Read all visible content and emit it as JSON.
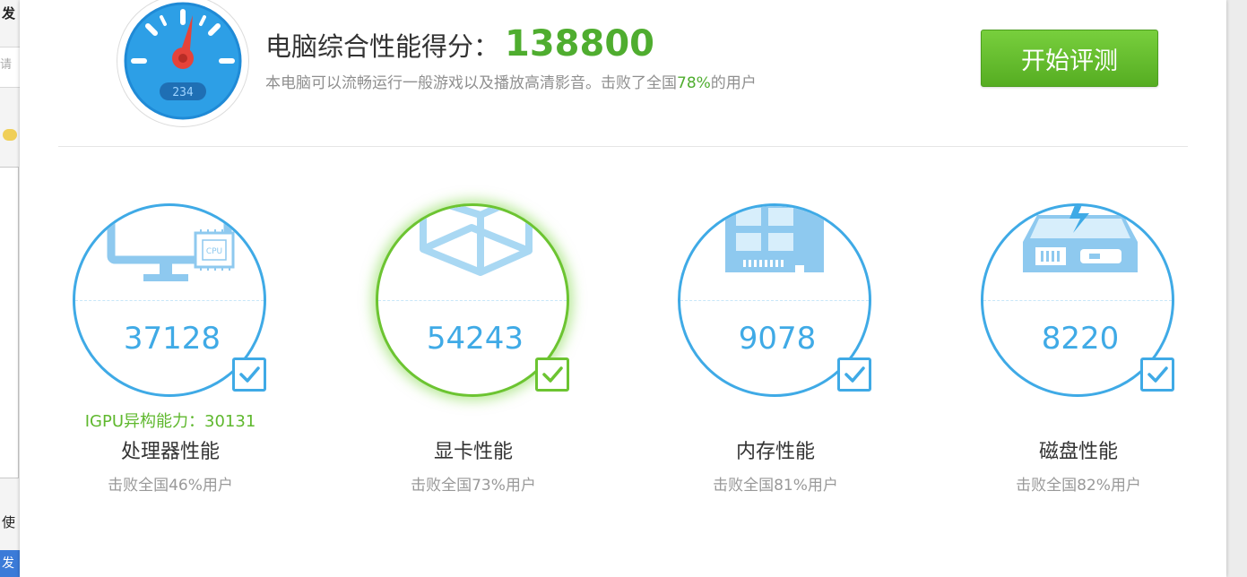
{
  "background": {
    "fragments": [
      "发",
      "请填",
      "使",
      "发"
    ]
  },
  "header": {
    "title_label": "电脑综合性能得分：",
    "total_score": "138800",
    "subtitle_prefix": "本电脑可以流畅运行一般游戏以及播放高清影音。击败了全国",
    "subtitle_percent": "78%",
    "subtitle_suffix": "的用户",
    "gauge_reading": "234",
    "start_button_label": "开始评测"
  },
  "cards": [
    {
      "name": "处理器性能",
      "score": "37128",
      "rank": "击败全国46%用户",
      "extra": "IGPU异构能力：30131",
      "icon": "cpu-monitor-icon",
      "checked": true
    },
    {
      "name": "显卡性能",
      "score": "54243",
      "rank": "击败全国73%用户",
      "extra": "",
      "icon": "gpu-cube-icon",
      "checked": true
    },
    {
      "name": "内存性能",
      "score": "9078",
      "rank": "击败全国81%用户",
      "extra": "",
      "icon": "memory-chip-icon",
      "checked": true
    },
    {
      "name": "磁盘性能",
      "score": "8220",
      "rank": "击败全国82%用户",
      "extra": "",
      "icon": "disk-drive-icon",
      "checked": true
    }
  ],
  "colors": {
    "accent_blue": "#3faae6",
    "accent_green": "#4fad2f",
    "gpu_ring": "#6cc431"
  }
}
